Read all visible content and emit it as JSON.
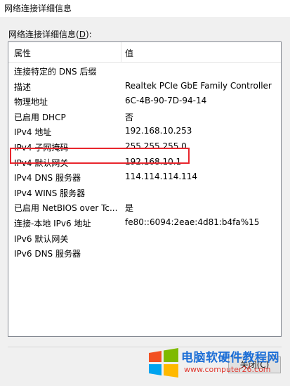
{
  "window": {
    "title": "网络连接详细信息"
  },
  "group": {
    "label": "网络连接详细信息(",
    "accesskey": "D",
    "label_suffix": "):"
  },
  "list": {
    "columns": [
      "属性",
      "值"
    ],
    "rows": [
      {
        "property": "连接特定的 DNS 后缀",
        "value": ""
      },
      {
        "property": "描述",
        "value": "Realtek PCIe GbE Family Controller"
      },
      {
        "property": "物理地址",
        "value": "6C-4B-90-7D-94-14"
      },
      {
        "property": "已启用 DHCP",
        "value": "否"
      },
      {
        "property": "IPv4 地址",
        "value": "192.168.10.253"
      },
      {
        "property": "IPv4 子网掩码",
        "value": "255.255.255.0"
      },
      {
        "property": "IPv4 默认网关",
        "value": "192.168.10.1",
        "highlighted": true
      },
      {
        "property": "IPv4 DNS 服务器",
        "value": "114.114.114.114"
      },
      {
        "property": "IPv4 WINS 服务器",
        "value": ""
      },
      {
        "property": "已启用 NetBIOS over Tc...",
        "value": "是"
      },
      {
        "property": "连接-本地 IPv6 地址",
        "value": "fe80::6094:2eae:4d81:b4fa%15"
      },
      {
        "property": "IPv6 默认网关",
        "value": ""
      },
      {
        "property": "IPv6 DNS 服务器",
        "value": ""
      }
    ]
  },
  "buttons": {
    "close_label": "关闭(C)"
  },
  "watermark": {
    "title": "电脑软硬件教程网",
    "url": "www.computer26.com"
  },
  "colors": {
    "highlight_border": "#e8262d",
    "watermark_title": "#1d6fd6",
    "watermark_url": "#e0372e"
  }
}
